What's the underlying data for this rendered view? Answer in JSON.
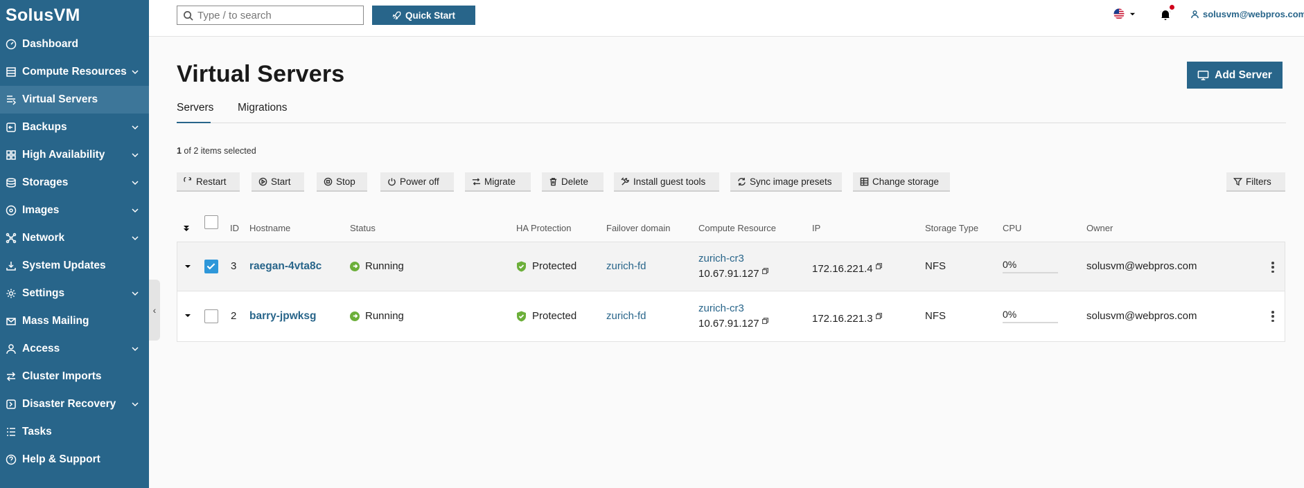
{
  "app": {
    "logo": "SolusVM"
  },
  "sidebar": {
    "items": [
      {
        "label": "Dashboard",
        "icon": "dashboard-icon",
        "has_children": false,
        "active": false
      },
      {
        "label": "Compute Resources",
        "icon": "compute-resources-icon",
        "has_children": true,
        "active": false
      },
      {
        "label": "Virtual Servers",
        "icon": "virtual-servers-icon",
        "has_children": false,
        "active": true
      },
      {
        "label": "Backups",
        "icon": "backups-icon",
        "has_children": true,
        "active": false
      },
      {
        "label": "High Availability",
        "icon": "high-availability-icon",
        "has_children": true,
        "active": false
      },
      {
        "label": "Storages",
        "icon": "storages-icon",
        "has_children": true,
        "active": false
      },
      {
        "label": "Images",
        "icon": "images-icon",
        "has_children": true,
        "active": false
      },
      {
        "label": "Network",
        "icon": "network-icon",
        "has_children": true,
        "active": false
      },
      {
        "label": "System Updates",
        "icon": "system-updates-icon",
        "has_children": false,
        "active": false
      },
      {
        "label": "Settings",
        "icon": "settings-icon",
        "has_children": true,
        "active": false
      },
      {
        "label": "Mass Mailing",
        "icon": "mail-icon",
        "has_children": false,
        "active": false
      },
      {
        "label": "Access",
        "icon": "user-icon",
        "has_children": true,
        "active": false
      },
      {
        "label": "Cluster Imports",
        "icon": "cluster-imports-icon",
        "has_children": false,
        "active": false
      },
      {
        "label": "Disaster Recovery",
        "icon": "disaster-recovery-icon",
        "has_children": true,
        "active": false
      },
      {
        "label": "Tasks",
        "icon": "tasks-icon",
        "has_children": false,
        "active": false
      },
      {
        "label": "Help & Support",
        "icon": "help-icon",
        "has_children": false,
        "active": false
      }
    ]
  },
  "topbar": {
    "search_placeholder": "Type / to search",
    "quick_start": "Quick Start",
    "user_email": "solusvm@webpros.com",
    "notification_dot_color": "#d0021b"
  },
  "main": {
    "title": "Virtual Servers",
    "add_server": "Add Server",
    "tabs": [
      {
        "label": "Servers",
        "active": true
      },
      {
        "label": "Migrations",
        "active": false
      }
    ],
    "selection": {
      "count": "1",
      "text": " of 2 items selected"
    },
    "toolbar": {
      "restart": "Restart",
      "start": "Start",
      "stop": "Stop",
      "power_off": "Power off",
      "migrate": "Migrate",
      "delete": "Delete",
      "install_guest_tools": "Install guest tools",
      "sync_image_presets": "Sync image presets",
      "change_storage": "Change storage",
      "filters": "Filters"
    },
    "table": {
      "columns": {
        "id": "ID",
        "hostname": "Hostname",
        "status": "Status",
        "ha": "HA Protection",
        "failover": "Failover domain",
        "compute": "Compute Resource",
        "ip": "IP",
        "storage": "Storage Type",
        "cpu": "CPU",
        "owner": "Owner"
      },
      "rows": [
        {
          "id": "3",
          "hostname": "raegan-4vta8c",
          "status": "Running",
          "ha": "Protected",
          "failover": "zurich-fd",
          "compute_name": "zurich-cr3",
          "compute_ip": "10.67.91.127",
          "ip": "172.16.221.4",
          "storage": "NFS",
          "cpu": "0%",
          "owner": "solusvm@webpros.com",
          "checked": true
        },
        {
          "id": "2",
          "hostname": "barry-jpwksg",
          "status": "Running",
          "ha": "Protected",
          "failover": "zurich-fd",
          "compute_name": "zurich-cr3",
          "compute_ip": "10.67.91.127",
          "ip": "172.16.221.3",
          "storage": "NFS",
          "cpu": "0%",
          "owner": "solusvm@webpros.com",
          "checked": false
        }
      ]
    }
  },
  "colors": {
    "sidebar_bg": "#28658a",
    "sidebar_active": "#3d7699",
    "accent": "#28658a",
    "running": "#6caf3a",
    "protected": "#6caf3a",
    "checkbox_checked": "#2e97d9"
  }
}
